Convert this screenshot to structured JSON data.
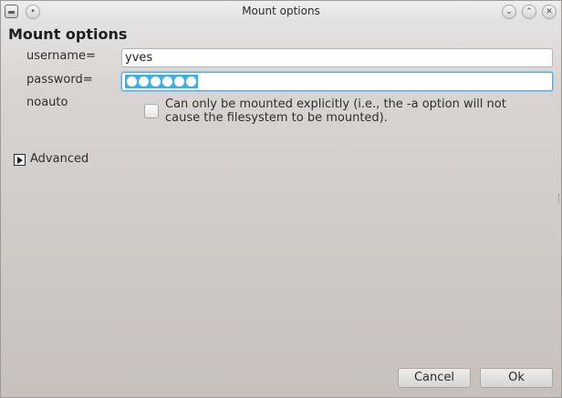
{
  "window": {
    "title": "Mount options",
    "icons": {
      "app": "drive-icon",
      "minimize": "minimize-icon",
      "maximize": "maximize-icon",
      "close": "close-icon"
    }
  },
  "heading": "Mount options",
  "form": {
    "username": {
      "label": "username=",
      "value": "yves"
    },
    "password": {
      "label": "password=",
      "masked_length": 6
    },
    "noauto": {
      "label": "noauto",
      "checkbox_checked": false,
      "description_line1": "Can only be mounted explicitly (i.e., the -a option will not",
      "description_line2": "cause the filesystem to be mounted)."
    }
  },
  "advanced": {
    "label": "Advanced",
    "expanded": false
  },
  "buttons": {
    "cancel": "Cancel",
    "ok": "Ok"
  },
  "colors": {
    "selection": "#3daee9",
    "focus_border": "#5fa9dc"
  }
}
